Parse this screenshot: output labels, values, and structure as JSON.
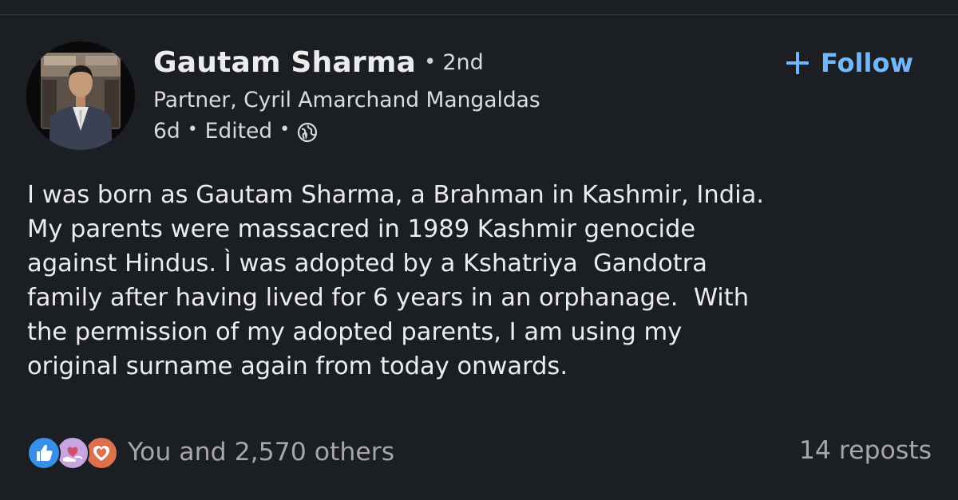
{
  "post": {
    "author": {
      "name": "Gautam Sharma",
      "degree_separator": "•",
      "degree": "2nd",
      "headline": "Partner, Cyril Amarchand Mangaldas",
      "avatar_icon": "profile-photo"
    },
    "meta": {
      "time": "6d",
      "separator": "•",
      "edited": "Edited",
      "visibility_icon": "globe-icon"
    },
    "follow": {
      "label": "Follow",
      "icon": "plus-icon",
      "color": "#71b7fb"
    },
    "body_lines": [
      "I was born as Gautam Sharma, a Brahman in Kashmir, India.",
      "My parents were massacred in 1989 Kashmir genocide",
      "against Hindus. Ì was adopted by a Kshatriya  Gandotra",
      "family after having lived for 6 years in an orphanage.  With",
      "the permission of my adopted parents, I am using my",
      "original surname again from today onwards."
    ],
    "social": {
      "reaction_icons": [
        "like-icon",
        "support-icon",
        "love-icon"
      ],
      "reactions_text": "You and 2,570 others",
      "reposts_text": "14 reposts"
    }
  },
  "colors": {
    "background": "#1b1f23",
    "accent": "#71b7fb",
    "like": "#378fe9",
    "support": "#c7a5e0",
    "love": "#df704d"
  }
}
